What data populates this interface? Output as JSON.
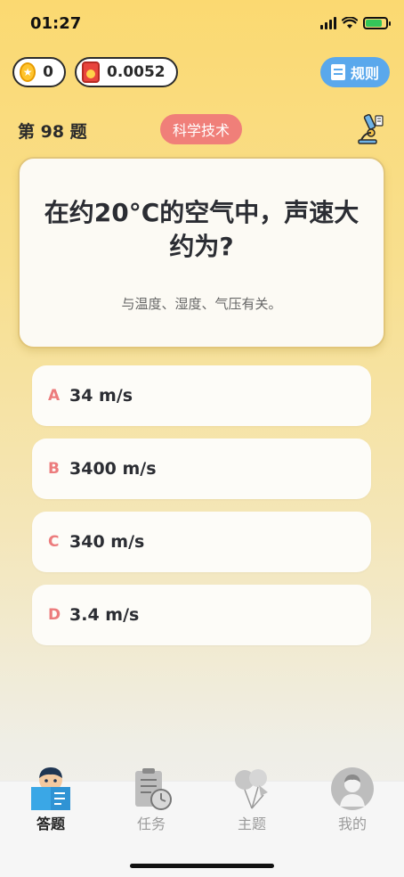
{
  "status": {
    "time": "01:27"
  },
  "wallet": {
    "coins": "0",
    "redpacket": "0.0052"
  },
  "rules_label": "规则",
  "question_number": "第 98 题",
  "category": "科学技术",
  "question": "在约20°C的空气中，声速大约为?",
  "hint": "与温度、湿度、气压有关。",
  "options": [
    {
      "letter": "A",
      "text": "34 m/s"
    },
    {
      "letter": "B",
      "text": "3400 m/s"
    },
    {
      "letter": "C",
      "text": "340 m/s"
    },
    {
      "letter": "D",
      "text": "3.4 m/s"
    }
  ],
  "tabs": [
    {
      "label": "答题",
      "icon": "reading-kid-icon",
      "active": true
    },
    {
      "label": "任务",
      "icon": "task-clipboard-icon",
      "active": false
    },
    {
      "label": "主题",
      "icon": "balloons-icon",
      "active": false
    },
    {
      "label": "我的",
      "icon": "avatar-icon",
      "active": false
    }
  ],
  "colors": {
    "accent_red": "#f07f79",
    "rules_blue": "#5aa8ec",
    "option_letter": "#ec7c7d"
  }
}
